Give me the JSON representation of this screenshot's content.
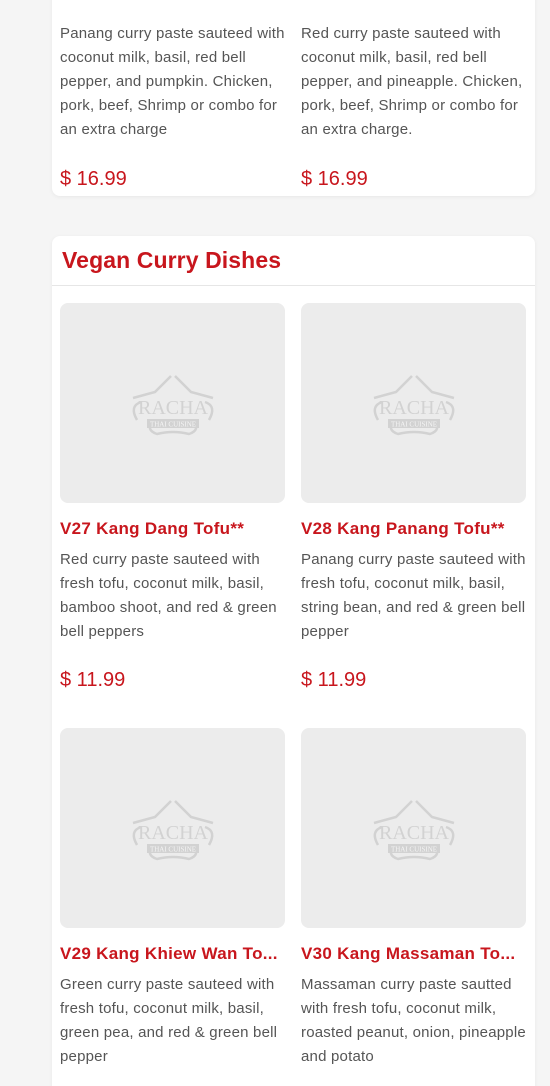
{
  "top_items": [
    {
      "description": "Panang curry paste sauteed with coconut milk, basil, red bell pepper, and pumpkin. Chicken, pork, beef, Shrimp or combo for an extra charge",
      "price": "$ 16.99"
    },
    {
      "description": "Red curry paste sauteed with coconut milk, basil, red bell pepper, and pineapple. Chicken, pork, beef, Shrimp or combo for an extra charge.",
      "price": "$ 16.99"
    }
  ],
  "section": {
    "title": "Vegan Curry Dishes",
    "image_logo": {
      "name": "RACHA",
      "tagline": "THAI CUISINE"
    },
    "items": [
      {
        "name": "V27 Kang Dang Tofu**",
        "description": "Red curry paste sauteed with fresh tofu, coconut milk, basil, bamboo shoot, and red & green bell peppers",
        "price": "$ 11.99"
      },
      {
        "name": "V28 Kang Panang Tofu**",
        "description": "Panang curry paste sauteed with fresh tofu, coconut milk, basil, string bean, and red & green bell pepper",
        "price": "$ 11.99"
      },
      {
        "name": "V29 Kang Khiew Wan To...",
        "description": "Green curry paste sauteed with fresh tofu, coconut milk, basil, green pea, and red & green bell pepper"
      },
      {
        "name": "V30 Kang Massaman To...",
        "description": "Massaman curry paste sautted with fresh tofu, coconut milk, roasted peanut, onion, pineapple and potato"
      }
    ]
  },
  "colors": {
    "accent": "#c8161d",
    "text": "#555555",
    "image_bg": "#ececec",
    "page_bg": "#f5f5f5"
  }
}
